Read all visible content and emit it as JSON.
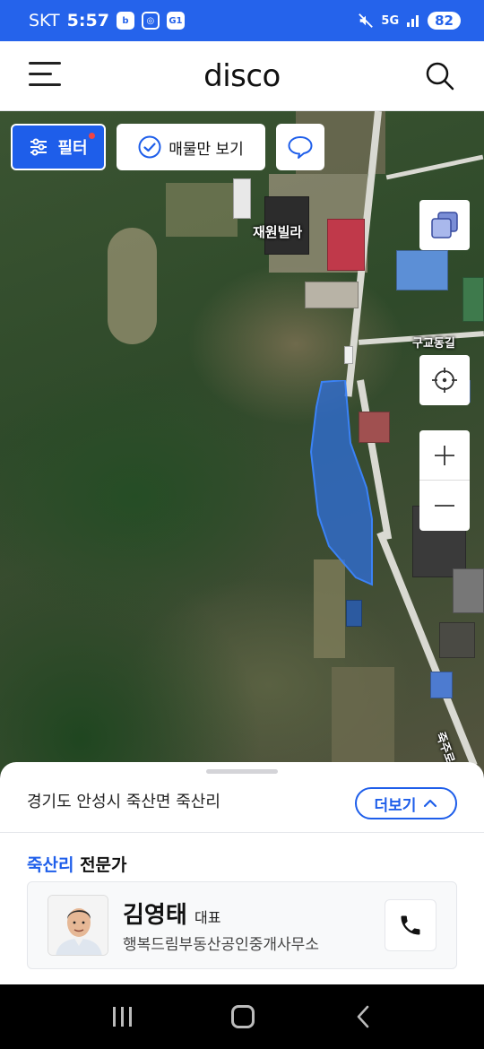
{
  "status_bar": {
    "carrier": "SKT",
    "time": "5:57",
    "icons_left": [
      "b-icon",
      "camera-icon",
      "g1-icon"
    ],
    "network": "5G",
    "battery": "82"
  },
  "header": {
    "logo": "disco"
  },
  "map": {
    "filter_label": "필터",
    "listing_only_label": "매물만 보기",
    "place_label": "재원빌라",
    "road_label": "구교동길",
    "road_label_2": "죽주로",
    "parcel_color": "#2f6fdc"
  },
  "sheet": {
    "address": "경기도 안성시 죽산면 죽산리",
    "more_label": "더보기",
    "expert_region": "죽산리",
    "expert_suffix": " 전문가",
    "agent": {
      "name": "김영태",
      "role": "대표",
      "office": "행복드림부동산공인중개사무소"
    }
  },
  "colors": {
    "accent": "#1e5eea",
    "status_bar": "#2563eb"
  }
}
